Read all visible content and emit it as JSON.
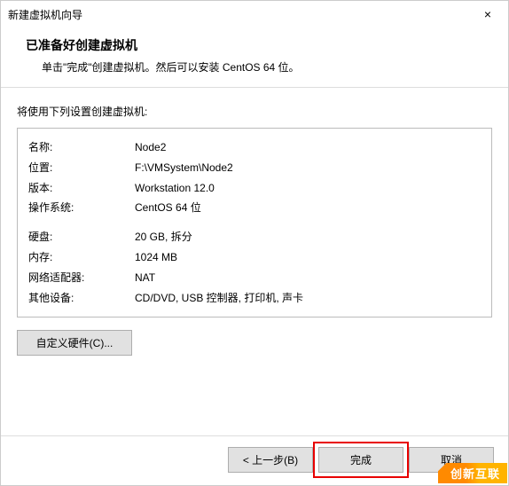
{
  "window": {
    "title": "新建虚拟机向导",
    "close_glyph": "×"
  },
  "header": {
    "title": "已准备好创建虚拟机",
    "subtitle": "单击\"完成\"创建虚拟机。然后可以安装 CentOS 64 位。"
  },
  "content": {
    "intro": "将使用下列设置创建虚拟机:",
    "rows1": [
      {
        "label": "名称:",
        "value": "Node2"
      },
      {
        "label": "位置:",
        "value": "F:\\VMSystem\\Node2"
      },
      {
        "label": "版本:",
        "value": "Workstation 12.0"
      },
      {
        "label": "操作系统:",
        "value": "CentOS 64 位"
      }
    ],
    "rows2": [
      {
        "label": "硬盘:",
        "value": "20 GB, 拆分"
      },
      {
        "label": "内存:",
        "value": "1024 MB"
      },
      {
        "label": "网络适配器:",
        "value": "NAT"
      },
      {
        "label": "其他设备:",
        "value": "CD/DVD, USB 控制器, 打印机, 声卡"
      }
    ],
    "customize_btn": "自定义硬件(C)..."
  },
  "footer": {
    "back": "< 上一步(B)",
    "finish": "完成",
    "cancel": "取消"
  },
  "watermark": "创新互联"
}
